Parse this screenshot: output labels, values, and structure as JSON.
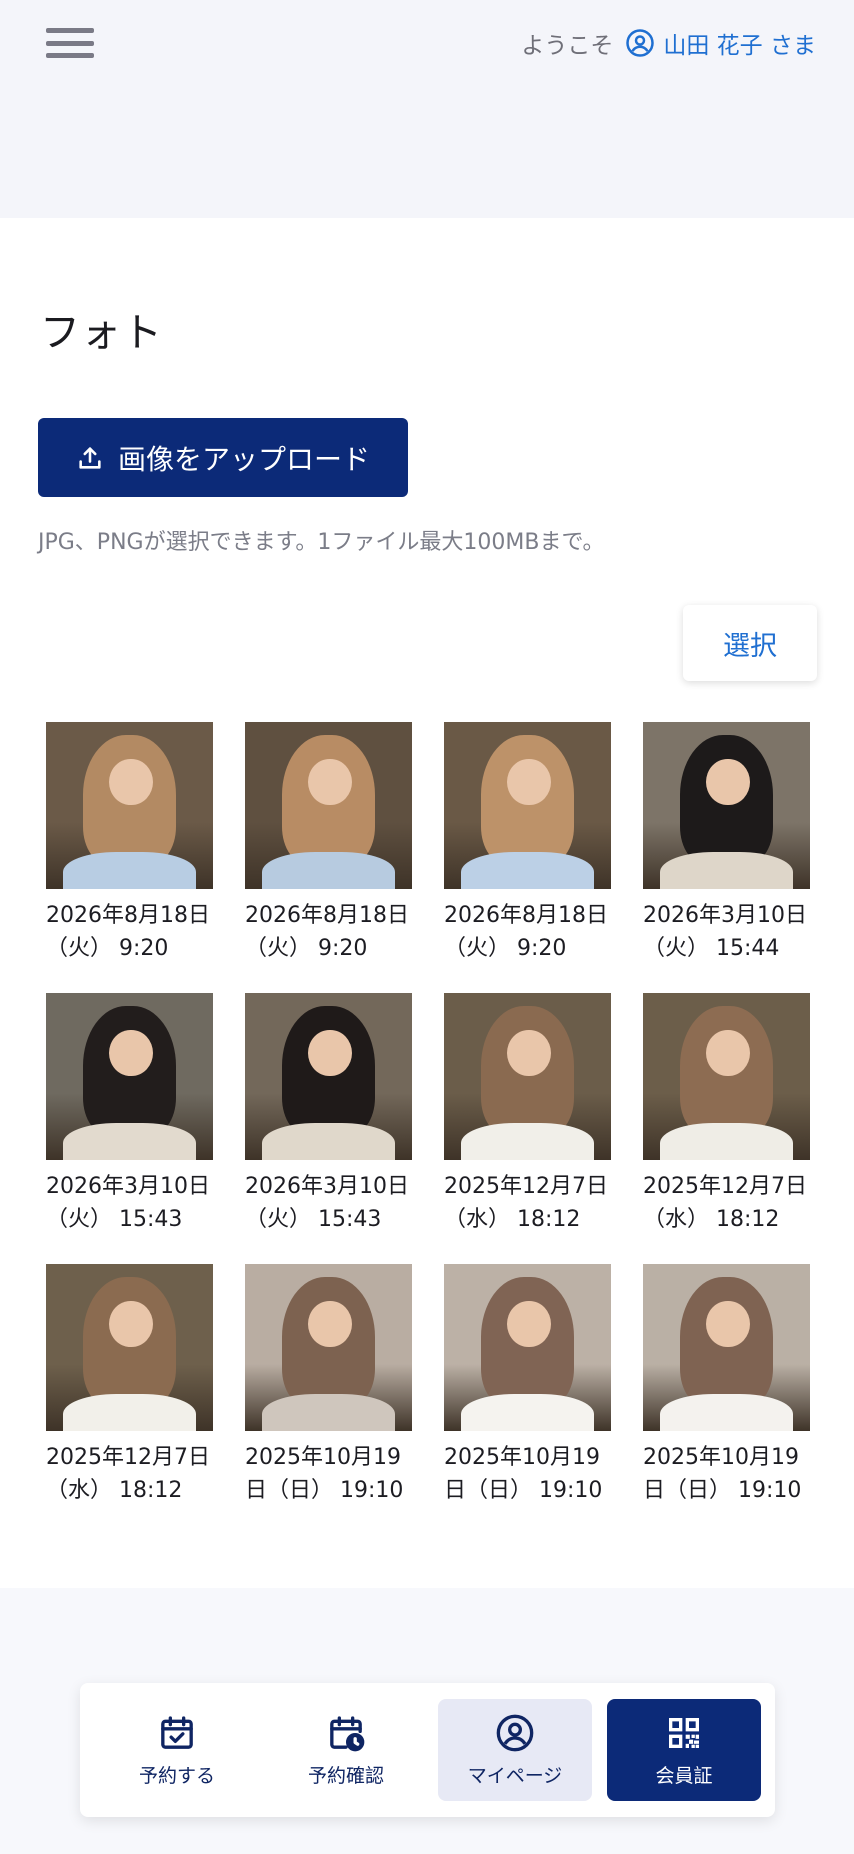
{
  "header": {
    "welcome": "ようこそ",
    "user_name": "山田 花子 さま"
  },
  "page": {
    "title": "フォト",
    "upload_label": "画像をアップロード",
    "hint": "JPG、PNGが選択できます。1ファイル最大100MBまで。",
    "select_label": "選択"
  },
  "photos": [
    {
      "date": "2026年8月18日\n（火） 9:20",
      "hair": "#b38a63",
      "bg": "#6b5a48",
      "shirt": "#b8cde3"
    },
    {
      "date": "2026年8月18日\n（火） 9:20",
      "hair": "#b88c64",
      "bg": "#5f5040",
      "shirt": "#b7cbe0"
    },
    {
      "date": "2026年8月18日\n（火） 9:20",
      "hair": "#bd9269",
      "bg": "#6a5946",
      "shirt": "#bcd0e6"
    },
    {
      "date": "2026年3月10日\n（火） 15:44",
      "hair": "#1d1a1a",
      "bg": "#7d7468",
      "shirt": "#ded6c9"
    },
    {
      "date": "2026年3月10日\n（火） 15:43",
      "hair": "#221d1c",
      "bg": "#6f6a60",
      "shirt": "#e2dace"
    },
    {
      "date": "2026年3月10日\n（火） 15:43",
      "hair": "#1f1a19",
      "bg": "#73685a",
      "shirt": "#e0d8cb"
    },
    {
      "date": "2025年12月7日\n（水） 18:12",
      "hair": "#8a6a50",
      "bg": "#6b5d4a",
      "shirt": "#f1efe9"
    },
    {
      "date": "2025年12月7日\n（水） 18:12",
      "hair": "#8d6c52",
      "bg": "#6c5e4a",
      "shirt": "#efede6"
    },
    {
      "date": "2025年12月7日\n（水） 18:12",
      "hair": "#8b6b50",
      "bg": "#6e604c",
      "shirt": "#f2f0ea"
    },
    {
      "date": "2025年10月19\n日（日） 19:10",
      "hair": "#7d6250",
      "bg": "#b9ada2",
      "shirt": "#cfc6bd"
    },
    {
      "date": "2025年10月19\n日（日） 19:10",
      "hair": "#806454",
      "bg": "#bcb1a6",
      "shirt": "#f5f3ef"
    },
    {
      "date": "2025年10月19\n日（日） 19:10",
      "hair": "#7f6352",
      "bg": "#bab0a5",
      "shirt": "#f4f2ee"
    }
  ],
  "nav": {
    "reserve": "予約する",
    "confirm": "予約確認",
    "mypage": "マイページ",
    "member_card": "会員証"
  },
  "colors": {
    "primary": "#0c2a78",
    "link": "#1f6fd1"
  }
}
